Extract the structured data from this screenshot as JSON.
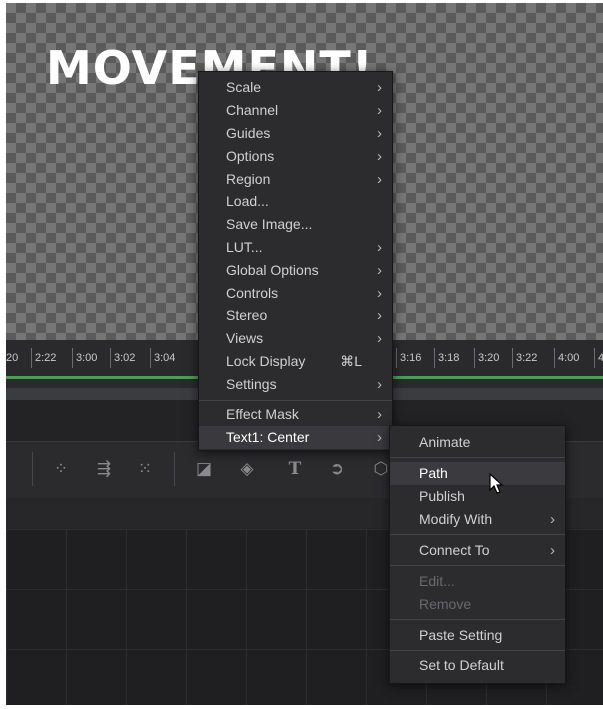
{
  "viewer": {
    "title_text": "MOVEMENT!"
  },
  "timeline": {
    "ticks": [
      "20",
      "2:22",
      "3:00",
      "3:02",
      "3:04",
      "3:16",
      "3:18",
      "3:20",
      "3:22",
      "4:00",
      "4"
    ],
    "accent_color": "#3da84a"
  },
  "toolbar": {
    "icons": [
      "particle-emitter-icon",
      "particle-render-icon",
      "particle-pixel-icon",
      "shape-3d-icon",
      "merge-3d-icon",
      "text-3d-icon",
      "camera-3d-icon",
      "renderer-3d-icon"
    ]
  },
  "context_menu": {
    "items": [
      {
        "label": "Scale",
        "submenu": true
      },
      {
        "label": "Channel",
        "submenu": true
      },
      {
        "label": "Guides",
        "submenu": true
      },
      {
        "label": "Options",
        "submenu": true
      },
      {
        "label": "Region",
        "submenu": true
      },
      {
        "label": "Load...",
        "submenu": false
      },
      {
        "label": "Save Image...",
        "submenu": false
      },
      {
        "label": "LUT...",
        "submenu": true
      },
      {
        "label": "Global Options",
        "submenu": true
      },
      {
        "label": "Controls",
        "submenu": true
      },
      {
        "label": "Stereo",
        "submenu": true
      },
      {
        "label": "Views",
        "submenu": true
      },
      {
        "label": "Lock Display",
        "shortcut": "⌘L",
        "submenu": false
      },
      {
        "label": "Settings",
        "submenu": true
      },
      {
        "label": "Effect Mask",
        "submenu": true
      },
      {
        "label": "Text1: Center",
        "submenu": true
      }
    ]
  },
  "submenu": {
    "items": [
      {
        "label": "Animate"
      },
      {
        "label": "Path"
      },
      {
        "label": "Publish"
      },
      {
        "label": "Modify With",
        "submenu": true
      },
      {
        "label": "Connect To",
        "submenu": true
      },
      {
        "label": "Edit...",
        "disabled": true
      },
      {
        "label": "Remove",
        "disabled": true
      },
      {
        "label": "Paste Setting"
      },
      {
        "label": "Set to Default"
      }
    ]
  }
}
